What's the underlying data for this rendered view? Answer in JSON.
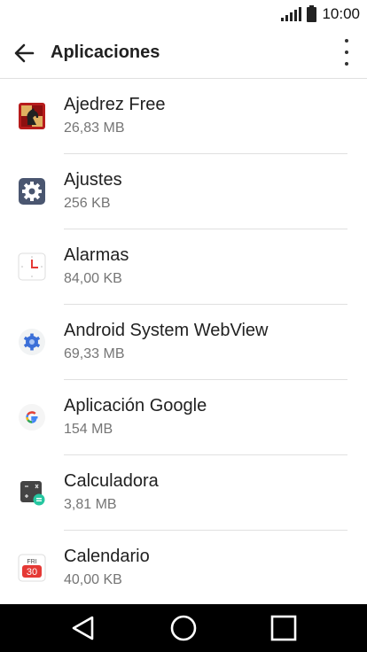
{
  "status_bar": {
    "time": "10:00"
  },
  "app_bar": {
    "title": "Aplicaciones"
  },
  "apps": [
    {
      "name": "Ajedrez Free",
      "size": "26,83 MB",
      "icon": "chess-app-icon"
    },
    {
      "name": "Ajustes",
      "size": "256 KB",
      "icon": "settings-gear-icon"
    },
    {
      "name": "Alarmas",
      "size": "84,00 KB",
      "icon": "clock-icon"
    },
    {
      "name": "Android System WebView",
      "size": "69,33 MB",
      "icon": "webview-gear-icon"
    },
    {
      "name": "Aplicación Google",
      "size": "154 MB",
      "icon": "google-g-icon"
    },
    {
      "name": "Calculadora",
      "size": "3,81 MB",
      "icon": "calculator-icon"
    },
    {
      "name": "Calendario",
      "size": "40,00 KB",
      "icon": "calendar-icon",
      "icon_text": {
        "day": "FRI",
        "date": "30"
      }
    }
  ],
  "colors": {
    "accent_google_blue": "#4285F4",
    "settings_bg": "#4a5670",
    "calendar_red": "#e53935"
  }
}
